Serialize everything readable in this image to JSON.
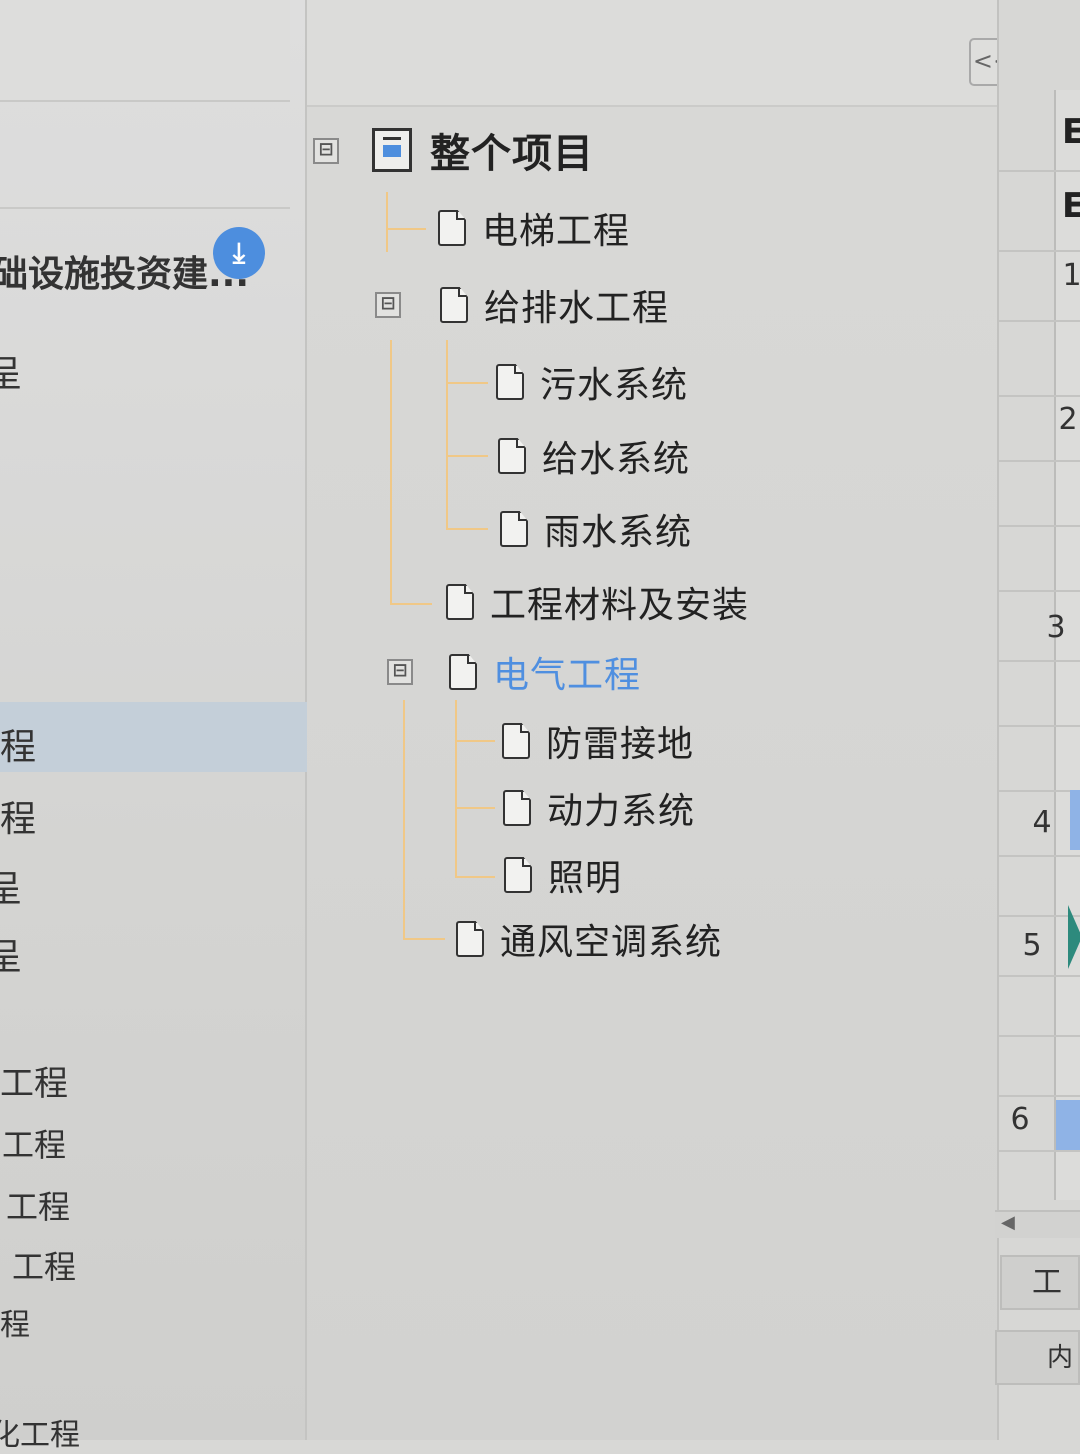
{
  "left_panel": {
    "project_name": "础设施投资建...",
    "items": [
      {
        "label": "程"
      },
      {
        "label": "程"
      },
      {
        "label": "工程"
      },
      {
        "label": "呈"
      },
      {
        "label": "呈"
      },
      {
        "label": "工程"
      },
      {
        "label": "工程"
      },
      {
        "label": "工程"
      },
      {
        "label": "工程"
      },
      {
        "label": "程"
      },
      {
        "label": "化工程"
      }
    ]
  },
  "tree": {
    "collapse_label": "<<",
    "root": {
      "label": "整个项目",
      "expander": "⊟"
    },
    "nodes": [
      {
        "label": "电梯工程"
      },
      {
        "label": "给排水工程",
        "expander": "⊟"
      },
      {
        "label": "污水系统"
      },
      {
        "label": "给水系统"
      },
      {
        "label": "雨水系统"
      },
      {
        "label": "工程材料及安装"
      },
      {
        "label": "电气工程",
        "expander": "⊟",
        "selected": true
      },
      {
        "label": "防雷接地"
      },
      {
        "label": "动力系统"
      },
      {
        "label": "照明"
      },
      {
        "label": "通风空调系统"
      }
    ]
  },
  "grid": {
    "col_headers": [
      "E",
      "E"
    ],
    "row_numbers": [
      "1",
      "2",
      "3",
      "4",
      "5",
      "6"
    ],
    "tabs": [
      "工",
      "内"
    ]
  },
  "colors": {
    "selected_text": "#4f8fe0",
    "tree_lines": "#f0c887",
    "accent": "#4d8ede"
  }
}
